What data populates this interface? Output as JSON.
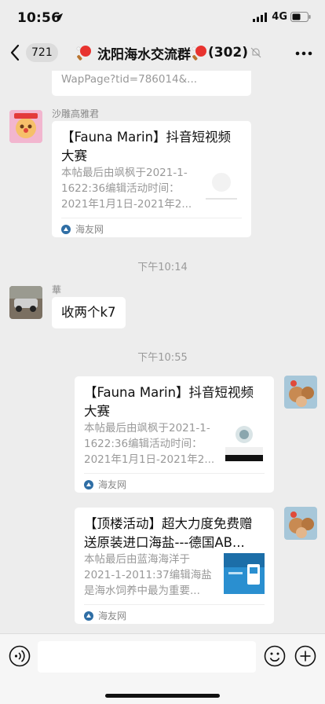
{
  "status_bar": {
    "time": "10:56",
    "network": "4G"
  },
  "nav": {
    "unread_count": "721",
    "title": "沈阳海水交流群",
    "member_count": "(302)"
  },
  "messages": {
    "partial_card": {
      "text": "WapPage?tid=786014&..."
    },
    "msg1": {
      "sender": "沙雕高雅君",
      "title": "【Fauna Marin】抖音短视频大赛",
      "desc_lines": [
        "本帖最后由飒枫于2021-1-",
        "1622:36编辑活动时间：",
        "2021年1月1日-2021年2..."
      ],
      "source": "海友网"
    },
    "time1": "下午10:14",
    "msg2": {
      "sender": "華",
      "text": "收两个k7"
    },
    "time2": "下午10:55",
    "msg3": {
      "title": "【Fauna Marin】抖音短视频大赛",
      "desc_lines": [
        "本帖最后由飒枫于2021-1-",
        "1622:36编辑活动时间：",
        "2021年1月1日-2021年2..."
      ],
      "source": "海友网"
    },
    "msg4": {
      "title": "【顶楼活动】超大力度免费赠送原装进口海盐---德国AB...",
      "desc_lines": [
        "本帖最后由蓝海海洋于",
        "2021-1-2011:37编辑海盐",
        "是海水饲养中最为重要..."
      ],
      "source": "海友网"
    }
  },
  "icons": {
    "back": "chevron-left-icon",
    "more": "ellipsis-icon",
    "mute": "bell-off-icon",
    "voice": "voice-icon",
    "emoji": "smile-icon",
    "plus": "plus-circle-icon"
  },
  "colors": {
    "background": "#ededed",
    "bubble": "#ffffff",
    "meta_text": "#999999"
  }
}
